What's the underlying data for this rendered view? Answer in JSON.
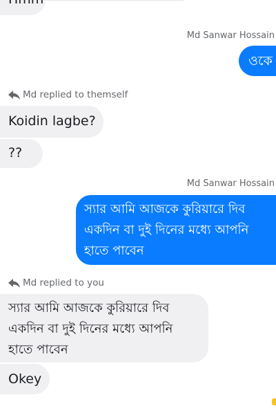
{
  "messages": {
    "m0": {
      "text": "Hmm"
    },
    "sender_1": "Md Sanwar Hossain",
    "m1": {
      "text": "ওকে"
    },
    "reply_1": {
      "label": "Md replied to themself",
      "icon": "reply-arrow-icon"
    },
    "m2": {
      "text": "Koidin lagbe?"
    },
    "m3": {
      "text": "??"
    },
    "sender_2": "Md Sanwar Hossain",
    "m4": {
      "line1": "স্যার আমি আজকে কুরিয়ারে দিব",
      "line2": "একদিন বা দুই দিনের মধ্যে আপনি",
      "line3": "হাতে পাবেন"
    },
    "reply_2": {
      "label": "Md replied to you",
      "icon": "reply-arrow-icon"
    },
    "m5": {
      "line1": "স্যার আমি আজকে কুরিয়ারে দিব",
      "line2": "একদিন বা দুই দিনের মধ্যে আপনি",
      "line3": "হাতে পাবেন"
    },
    "m6": {
      "text": "Okey"
    }
  },
  "colors": {
    "outgoing_bubble": "#0a7cff",
    "incoming_bubble": "#f0f0f3",
    "meta_text": "#65676b",
    "reaction_dot": "#f5c518"
  }
}
